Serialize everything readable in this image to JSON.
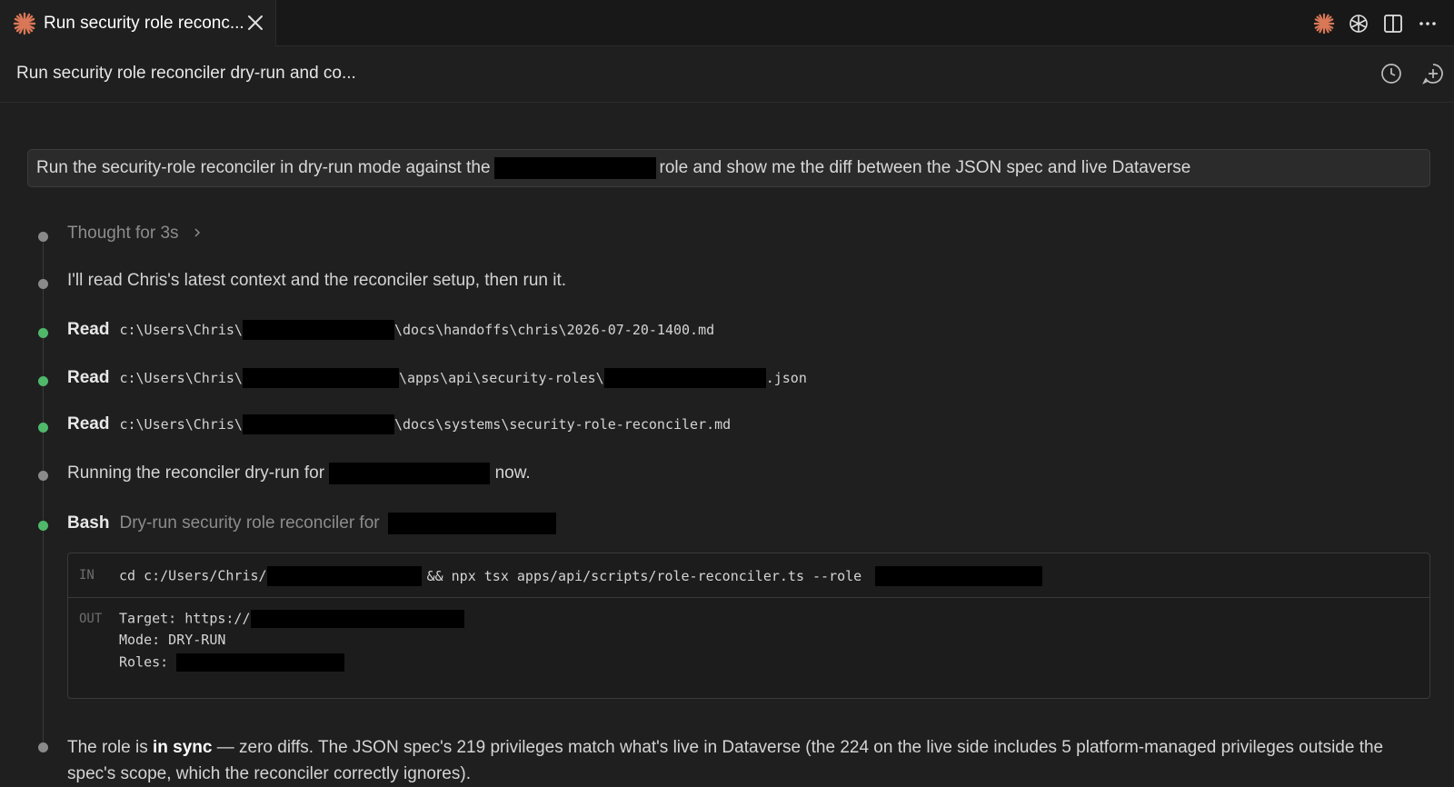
{
  "tab": {
    "title": "Run security role reconc...",
    "icons": [
      "claude-spark-icon",
      "close-icon"
    ]
  },
  "tab_actions": [
    "claude-spark-icon",
    "openai-icon",
    "split-editor-icon",
    "more-icon"
  ],
  "header": {
    "title": "Run security role reconciler dry-run and co...",
    "actions": [
      "history-icon",
      "new-chat-icon"
    ]
  },
  "prompt": {
    "before": "Run the security-role reconciler in dry-run mode against the",
    "after": "role and show me the diff between the JSON spec and live Dataverse"
  },
  "thought": {
    "label": "Thought for 3s"
  },
  "intro": "I'll read Chris's latest context and the reconciler setup, then run it.",
  "reads": [
    {
      "kw": "Read",
      "prefix": "c:\\Users\\Chris\\",
      "mid": "\\docs\\handoffs\\chris\\2026-07-20-1400.md",
      "suffix": ""
    },
    {
      "kw": "Read",
      "prefix": "c:\\Users\\Chris\\",
      "mid": "\\apps\\api\\security-roles\\",
      "suffix": ".json"
    },
    {
      "kw": "Read",
      "prefix": "c:\\Users\\Chris\\",
      "mid": "\\docs\\systems\\security-role-reconciler.md",
      "suffix": ""
    }
  ],
  "running": {
    "before": "Running the reconciler dry-run for",
    "after": "now."
  },
  "bash": {
    "kw": "Bash",
    "desc": "Dry-run security role reconciler for",
    "in_label": "IN",
    "out_label": "OUT",
    "cmd_before": "cd c:/Users/Chris/",
    "cmd_after": "&& npx tsx apps/api/scripts/role-reconciler.ts --role",
    "out_target": "Target: https://",
    "out_mode": "Mode: DRY-RUN",
    "out_roles": "Roles:"
  },
  "final": {
    "a": "The role is ",
    "b": "in sync",
    "c": " — zero diffs. The JSON spec's 219 privileges match what's live in Dataverse (the 224 on the live side includes 5 platform-managed privileges outside the spec's scope, which the reconciler correctly ignores)."
  },
  "colors": {
    "bg": "#1f1f1f",
    "accent_orange": "#d97757",
    "success_dot": "#4fb86a",
    "redaction": "#000000"
  }
}
